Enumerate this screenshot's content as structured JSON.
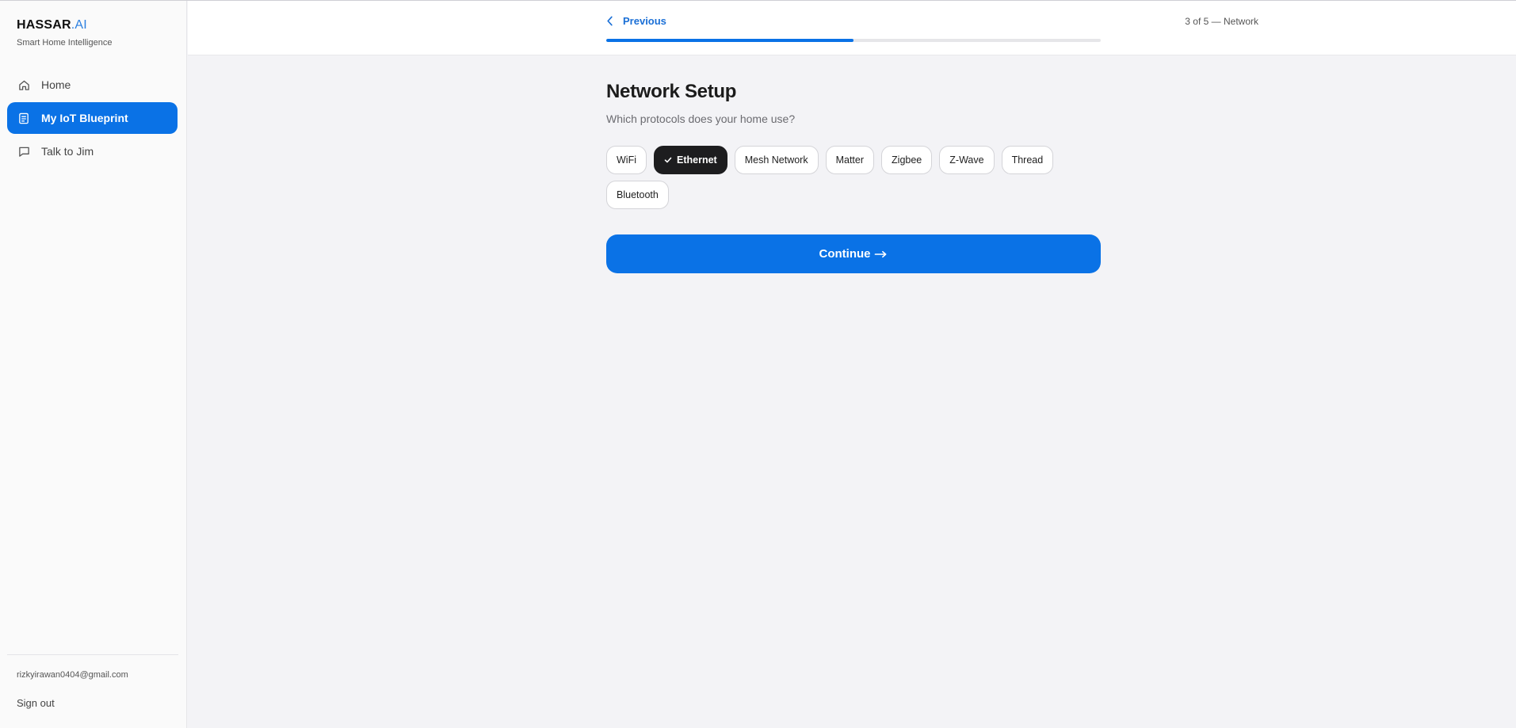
{
  "brand": {
    "name": "HASSAR",
    "suffix": ".AI",
    "tagline": "Smart Home Intelligence"
  },
  "sidebar": {
    "items": [
      {
        "label": "Home",
        "icon": "home-icon",
        "active": false
      },
      {
        "label": "My IoT Blueprint",
        "icon": "document-icon",
        "active": true
      },
      {
        "label": "Talk to Jim",
        "icon": "chat-icon",
        "active": false
      }
    ],
    "user_email": "rizkyirawan0404@gmail.com",
    "signout_label": "Sign out"
  },
  "header": {
    "previous_label": "Previous",
    "step_label": "3 of 5 — Network",
    "progress": 0.5
  },
  "main": {
    "title": "Network Setup",
    "subtitle": "Which protocols does your home use?",
    "protocols": [
      {
        "label": "WiFi",
        "selected": false
      },
      {
        "label": "Ethernet",
        "selected": true
      },
      {
        "label": "Mesh Network",
        "selected": false
      },
      {
        "label": "Matter",
        "selected": false
      },
      {
        "label": "Zigbee",
        "selected": false
      },
      {
        "label": "Z-Wave",
        "selected": false
      },
      {
        "label": "Thread",
        "selected": false
      },
      {
        "label": "Bluetooth",
        "selected": false
      }
    ],
    "continue_label": "Continue"
  },
  "colors": {
    "accent": "#0a72e6",
    "selected_chip": "#1d1d1f",
    "background": "#f3f3f6"
  }
}
